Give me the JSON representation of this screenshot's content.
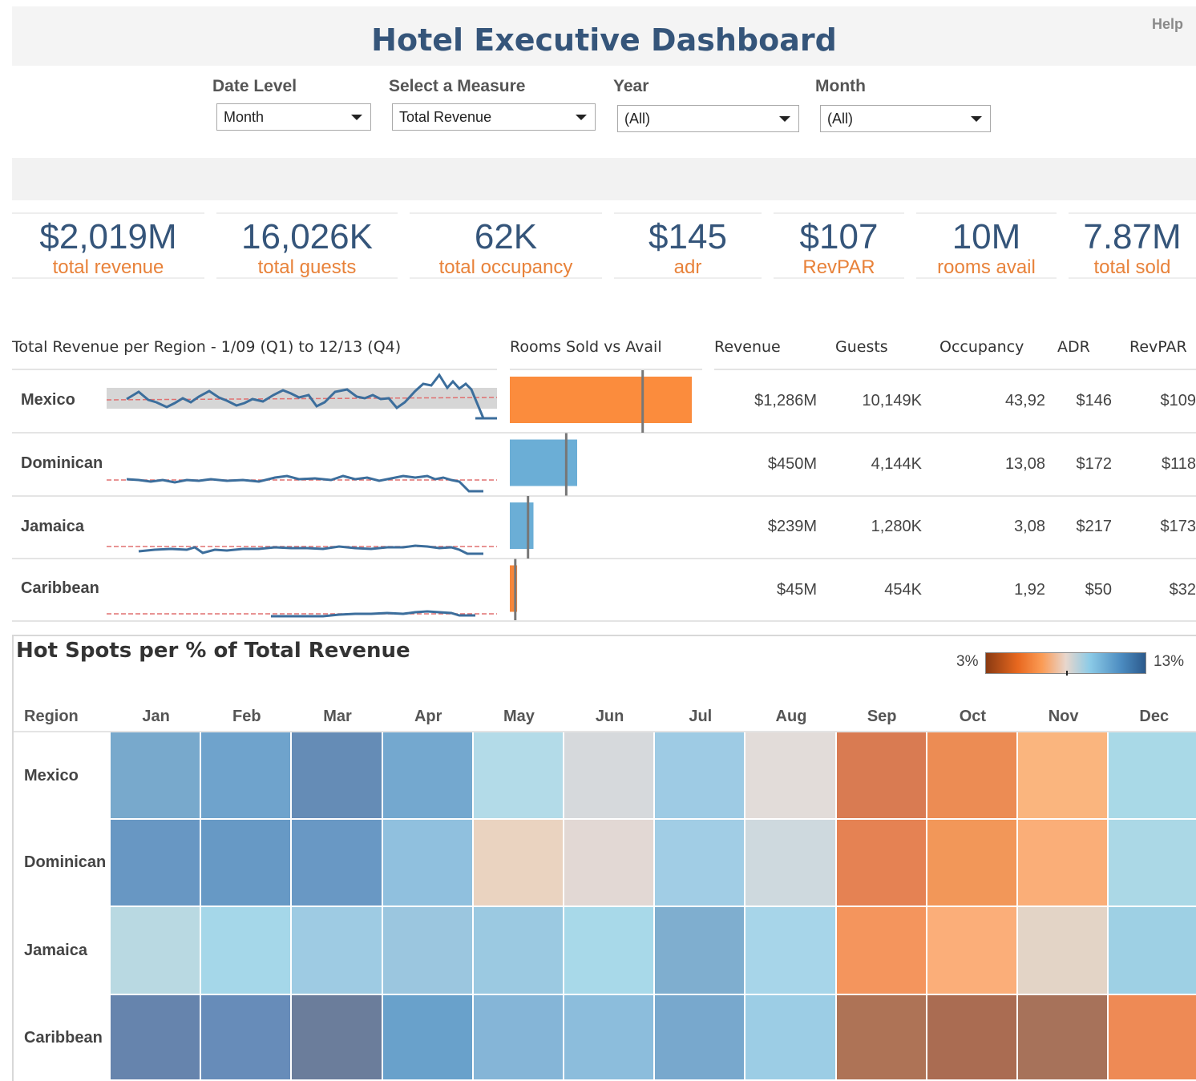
{
  "header": {
    "title": "Hotel Executive Dashboard",
    "help_label": "Help"
  },
  "filters": [
    {
      "label": "Date Level",
      "value": "Month"
    },
    {
      "label": "Select a Measure",
      "value": "Total Revenue"
    },
    {
      "label": "Year",
      "value": "(All)"
    },
    {
      "label": "Month",
      "value": "(All)"
    }
  ],
  "kpis": [
    {
      "value": "$2,019M",
      "label": "total revenue"
    },
    {
      "value": "16,026K",
      "label": "total guests"
    },
    {
      "value": "62K",
      "label": "total occupancy"
    },
    {
      "value": "$145",
      "label": "adr"
    },
    {
      "value": "$107",
      "label": "RevPAR"
    },
    {
      "value": "10M",
      "label": "rooms avail"
    },
    {
      "value": "7.87M",
      "label": "total sold"
    }
  ],
  "region_table": {
    "headers": {
      "trend": "Total Revenue per Region - 1/09 (Q1) to 12/13 (Q4)",
      "rooms": "Rooms Sold vs Avail",
      "revenue": "Revenue",
      "guests": "Guests",
      "occupancy": "Occupancy",
      "adr": "ADR",
      "revpar": "RevPAR"
    },
    "rows": [
      {
        "region": "Mexico",
        "revenue": "$1,286M",
        "guests": "10,149K",
        "occupancy": "43,92",
        "adr": "$146",
        "revpar": "$109"
      },
      {
        "region": "Dominican",
        "revenue": "$450M",
        "guests": "4,144K",
        "occupancy": "13,08",
        "adr": "$172",
        "revpar": "$118"
      },
      {
        "region": "Jamaica",
        "revenue": "$239M",
        "guests": "1,280K",
        "occupancy": "3,08",
        "adr": "$217",
        "revpar": "$173"
      },
      {
        "region": "Caribbean",
        "revenue": "$45M",
        "guests": "454K",
        "occupancy": "1,92",
        "adr": "$50",
        "revpar": "$32"
      }
    ]
  },
  "chart_data": [
    {
      "type": "bar",
      "title": "Rooms Sold vs Avail",
      "categories": [
        "Mexico",
        "Dominican",
        "Jamaica",
        "Caribbean"
      ],
      "series": [
        {
          "values": [
            1.0,
            0.37,
            0.13,
            0.04
          ]
        },
        {
          "values": [
            0.73,
            0.31,
            0.1,
            0.03
          ]
        }
      ],
      "colors": [
        "#fb8c3d",
        "#6baed6",
        "#6baed6",
        "#f6863a"
      ],
      "reference_line_color": "#777777"
    },
    {
      "type": "heatmap",
      "title": "Hot Spots per % of Total Revenue",
      "row_header": "Region",
      "columns": [
        "Jan",
        "Feb",
        "Mar",
        "Apr",
        "May",
        "Jun",
        "Jul",
        "Aug",
        "Sep",
        "Oct",
        "Nov",
        "Dec"
      ],
      "rows": [
        "Mexico",
        "Dominican",
        "Jamaica",
        "Caribbean"
      ],
      "color_scale": {
        "min_label": "3%",
        "max_label": "13%"
      },
      "cell_colors": [
        [
          "#78a9cc",
          "#6fa3cc",
          "#658cb6",
          "#74a8cf",
          "#b3dbe8",
          "#d6d9dc",
          "#9ecbe4",
          "#e2dcd9",
          "#d97b52",
          "#ec8c54",
          "#fab57e",
          "#a9d9e7"
        ],
        [
          "#6897c3",
          "#6799c5",
          "#6998c4",
          "#90c0de",
          "#ead3c0",
          "#e2d8d4",
          "#a1cde5",
          "#ced9de",
          "#e58253",
          "#f29759",
          "#faae78",
          "#abd8e6"
        ],
        [
          "#b9d9e2",
          "#a5d7e9",
          "#9ecbe3",
          "#9bc6df",
          "#9bc9e1",
          "#a8d9e9",
          "#7faecf",
          "#a7d5e9",
          "#f4955d",
          "#fbae79",
          "#e3d4c6",
          "#9ed0e4"
        ],
        [
          "#6684ad",
          "#678cb9",
          "#6b7d9b",
          "#69a1cb",
          "#85b5d7",
          "#8cbddc",
          "#78a8cd",
          "#9ccde5",
          "#ae7356",
          "#aa6c52",
          "#a7725a",
          "#ee8a55"
        ]
      ]
    }
  ]
}
